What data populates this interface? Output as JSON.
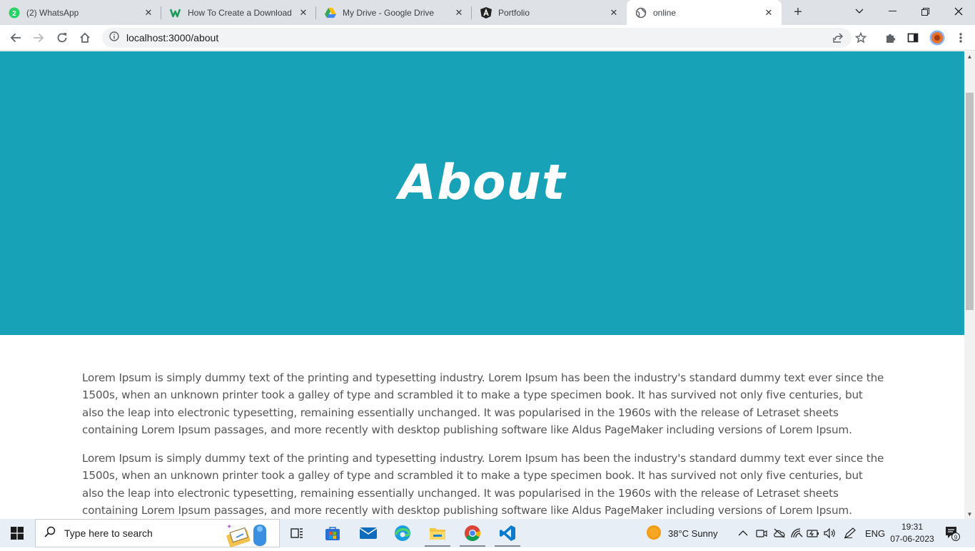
{
  "browser": {
    "tabs": [
      {
        "title": "(2) WhatsApp",
        "icon": "whatsapp-icon",
        "badge": "2"
      },
      {
        "title": "How To Create a Download Button",
        "icon": "w-logo-icon"
      },
      {
        "title": "My Drive - Google Drive",
        "icon": "google-drive-icon"
      },
      {
        "title": "Portfolio",
        "icon": "angular-icon"
      },
      {
        "title": "online",
        "icon": "globe-icon",
        "active": true
      }
    ],
    "url": "localhost:3000/about"
  },
  "page": {
    "hero_title": "About",
    "hero_color": "#17a2b8",
    "paragraphs": [
      "Lorem Ipsum is simply dummy text of the printing and typesetting industry. Lorem Ipsum has been the industry's standard dummy text ever since the 1500s, when an unknown printer took a galley of type and scrambled it to make a type specimen book. It has survived not only five centuries, but also the leap into electronic typesetting, remaining essentially unchanged. It was popularised in the 1960s with the release of Letraset sheets containing Lorem Ipsum passages, and more recently with desktop publishing software like Aldus PageMaker including versions of Lorem Ipsum.",
      "Lorem Ipsum is simply dummy text of the printing and typesetting industry. Lorem Ipsum has been the industry's standard dummy text ever since the 1500s, when an unknown printer took a galley of type and scrambled it to make a type specimen book. It has survived not only five centuries, but also the leap into electronic typesetting, remaining essentially unchanged. It was popularised in the 1960s with the release of Letraset sheets containing Lorem Ipsum passages, and more recently with desktop publishing software like Aldus PageMaker including versions of Lorem Ipsum."
    ]
  },
  "taskbar": {
    "search_placeholder": "Type here to search",
    "weather": "38°C  Sunny",
    "language": "ENG",
    "time": "19:31",
    "date": "07-06-2023",
    "notification_count": "9"
  }
}
